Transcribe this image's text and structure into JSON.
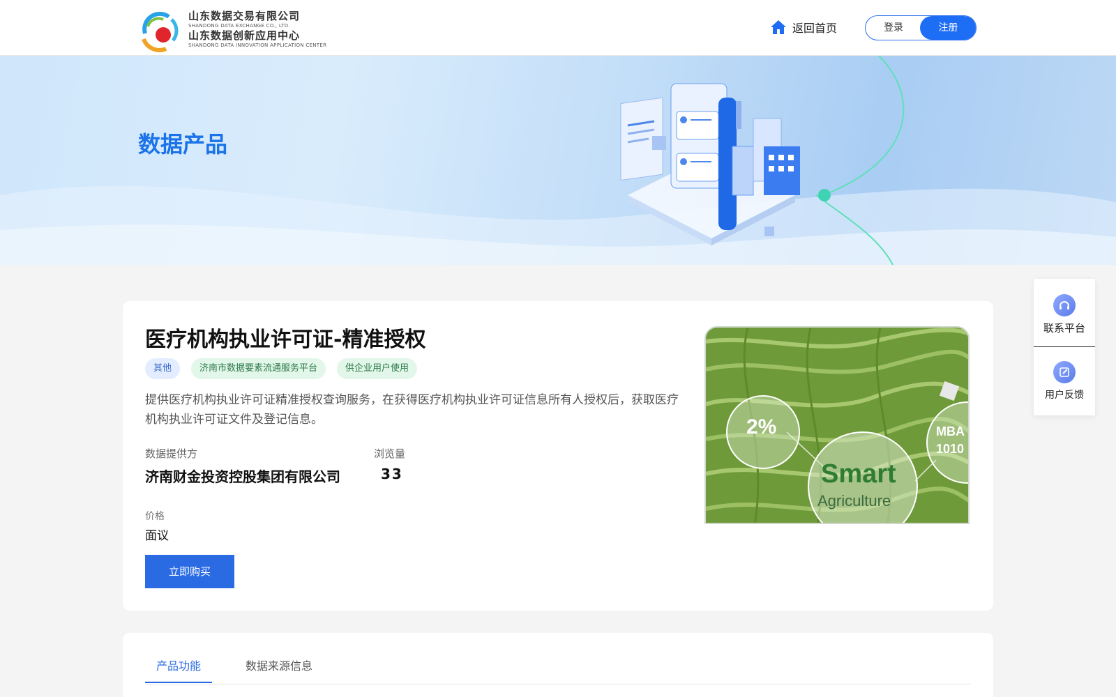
{
  "header": {
    "logo_cn_1": "山东数据交易有限公司",
    "logo_en_1": "SHANDONG DATA EXCHANGE CO., LTD.",
    "logo_cn_2": "山东数据创新应用中心",
    "logo_en_2": "SHANDONG DATA INNOVATION APPLICATION CENTER",
    "home_label": "返回首页",
    "login_label": "登录",
    "register_label": "注册"
  },
  "banner": {
    "title": "数据产品"
  },
  "product": {
    "title": "医疗机构执业许可证-精准授权",
    "tags": [
      "其他",
      "济南市数据要素流通服务平台",
      "供企业用户使用"
    ],
    "description": "提供医疗机构执业许可证精准授权查询服务，在获得医疗机构执业许可证信息所有人授权后，获取医疗机构执业许可证文件及登记信息。",
    "provider_label": "数据提供方",
    "provider_value": "济南财金投资控股集团有限公司",
    "views_label": "浏览量",
    "views_value": "33",
    "price_label": "价格",
    "price_value": "面议",
    "buy_label": "立即购买",
    "image_text": {
      "percent": "2%",
      "smart": "Smart",
      "agri": "Agriculture",
      "mba": "MBA",
      "num": "1010"
    }
  },
  "tabs": [
    {
      "label": "产品功能",
      "active": true
    },
    {
      "label": "数据来源信息",
      "active": false
    }
  ],
  "side": {
    "contact_label": "联系平台",
    "feedback_label": "用户反馈"
  },
  "colors": {
    "accent": "#1e6df5",
    "title_blue": "#1a73e8"
  }
}
